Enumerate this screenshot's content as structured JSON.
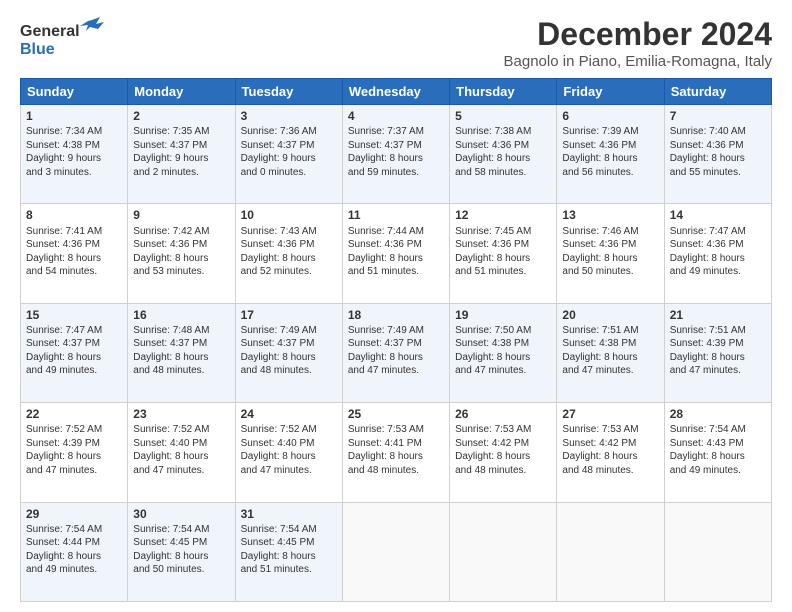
{
  "header": {
    "logo_general": "General",
    "logo_blue": "Blue",
    "month_title": "December 2024",
    "location": "Bagnolo in Piano, Emilia-Romagna, Italy"
  },
  "weekdays": [
    "Sunday",
    "Monday",
    "Tuesday",
    "Wednesday",
    "Thursday",
    "Friday",
    "Saturday"
  ],
  "weeks": [
    [
      {
        "day": "1",
        "info": "Sunrise: 7:34 AM\nSunset: 4:38 PM\nDaylight: 9 hours\nand 3 minutes."
      },
      {
        "day": "2",
        "info": "Sunrise: 7:35 AM\nSunset: 4:37 PM\nDaylight: 9 hours\nand 2 minutes."
      },
      {
        "day": "3",
        "info": "Sunrise: 7:36 AM\nSunset: 4:37 PM\nDaylight: 9 hours\nand 0 minutes."
      },
      {
        "day": "4",
        "info": "Sunrise: 7:37 AM\nSunset: 4:37 PM\nDaylight: 8 hours\nand 59 minutes."
      },
      {
        "day": "5",
        "info": "Sunrise: 7:38 AM\nSunset: 4:36 PM\nDaylight: 8 hours\nand 58 minutes."
      },
      {
        "day": "6",
        "info": "Sunrise: 7:39 AM\nSunset: 4:36 PM\nDaylight: 8 hours\nand 56 minutes."
      },
      {
        "day": "7",
        "info": "Sunrise: 7:40 AM\nSunset: 4:36 PM\nDaylight: 8 hours\nand 55 minutes."
      }
    ],
    [
      {
        "day": "8",
        "info": "Sunrise: 7:41 AM\nSunset: 4:36 PM\nDaylight: 8 hours\nand 54 minutes."
      },
      {
        "day": "9",
        "info": "Sunrise: 7:42 AM\nSunset: 4:36 PM\nDaylight: 8 hours\nand 53 minutes."
      },
      {
        "day": "10",
        "info": "Sunrise: 7:43 AM\nSunset: 4:36 PM\nDaylight: 8 hours\nand 52 minutes."
      },
      {
        "day": "11",
        "info": "Sunrise: 7:44 AM\nSunset: 4:36 PM\nDaylight: 8 hours\nand 51 minutes."
      },
      {
        "day": "12",
        "info": "Sunrise: 7:45 AM\nSunset: 4:36 PM\nDaylight: 8 hours\nand 51 minutes."
      },
      {
        "day": "13",
        "info": "Sunrise: 7:46 AM\nSunset: 4:36 PM\nDaylight: 8 hours\nand 50 minutes."
      },
      {
        "day": "14",
        "info": "Sunrise: 7:47 AM\nSunset: 4:36 PM\nDaylight: 8 hours\nand 49 minutes."
      }
    ],
    [
      {
        "day": "15",
        "info": "Sunrise: 7:47 AM\nSunset: 4:37 PM\nDaylight: 8 hours\nand 49 minutes."
      },
      {
        "day": "16",
        "info": "Sunrise: 7:48 AM\nSunset: 4:37 PM\nDaylight: 8 hours\nand 48 minutes."
      },
      {
        "day": "17",
        "info": "Sunrise: 7:49 AM\nSunset: 4:37 PM\nDaylight: 8 hours\nand 48 minutes."
      },
      {
        "day": "18",
        "info": "Sunrise: 7:49 AM\nSunset: 4:37 PM\nDaylight: 8 hours\nand 47 minutes."
      },
      {
        "day": "19",
        "info": "Sunrise: 7:50 AM\nSunset: 4:38 PM\nDaylight: 8 hours\nand 47 minutes."
      },
      {
        "day": "20",
        "info": "Sunrise: 7:51 AM\nSunset: 4:38 PM\nDaylight: 8 hours\nand 47 minutes."
      },
      {
        "day": "21",
        "info": "Sunrise: 7:51 AM\nSunset: 4:39 PM\nDaylight: 8 hours\nand 47 minutes."
      }
    ],
    [
      {
        "day": "22",
        "info": "Sunrise: 7:52 AM\nSunset: 4:39 PM\nDaylight: 8 hours\nand 47 minutes."
      },
      {
        "day": "23",
        "info": "Sunrise: 7:52 AM\nSunset: 4:40 PM\nDaylight: 8 hours\nand 47 minutes."
      },
      {
        "day": "24",
        "info": "Sunrise: 7:52 AM\nSunset: 4:40 PM\nDaylight: 8 hours\nand 47 minutes."
      },
      {
        "day": "25",
        "info": "Sunrise: 7:53 AM\nSunset: 4:41 PM\nDaylight: 8 hours\nand 48 minutes."
      },
      {
        "day": "26",
        "info": "Sunrise: 7:53 AM\nSunset: 4:42 PM\nDaylight: 8 hours\nand 48 minutes."
      },
      {
        "day": "27",
        "info": "Sunrise: 7:53 AM\nSunset: 4:42 PM\nDaylight: 8 hours\nand 48 minutes."
      },
      {
        "day": "28",
        "info": "Sunrise: 7:54 AM\nSunset: 4:43 PM\nDaylight: 8 hours\nand 49 minutes."
      }
    ],
    [
      {
        "day": "29",
        "info": "Sunrise: 7:54 AM\nSunset: 4:44 PM\nDaylight: 8 hours\nand 49 minutes."
      },
      {
        "day": "30",
        "info": "Sunrise: 7:54 AM\nSunset: 4:45 PM\nDaylight: 8 hours\nand 50 minutes."
      },
      {
        "day": "31",
        "info": "Sunrise: 7:54 AM\nSunset: 4:45 PM\nDaylight: 8 hours\nand 51 minutes."
      },
      {
        "day": "",
        "info": ""
      },
      {
        "day": "",
        "info": ""
      },
      {
        "day": "",
        "info": ""
      },
      {
        "day": "",
        "info": ""
      }
    ]
  ]
}
